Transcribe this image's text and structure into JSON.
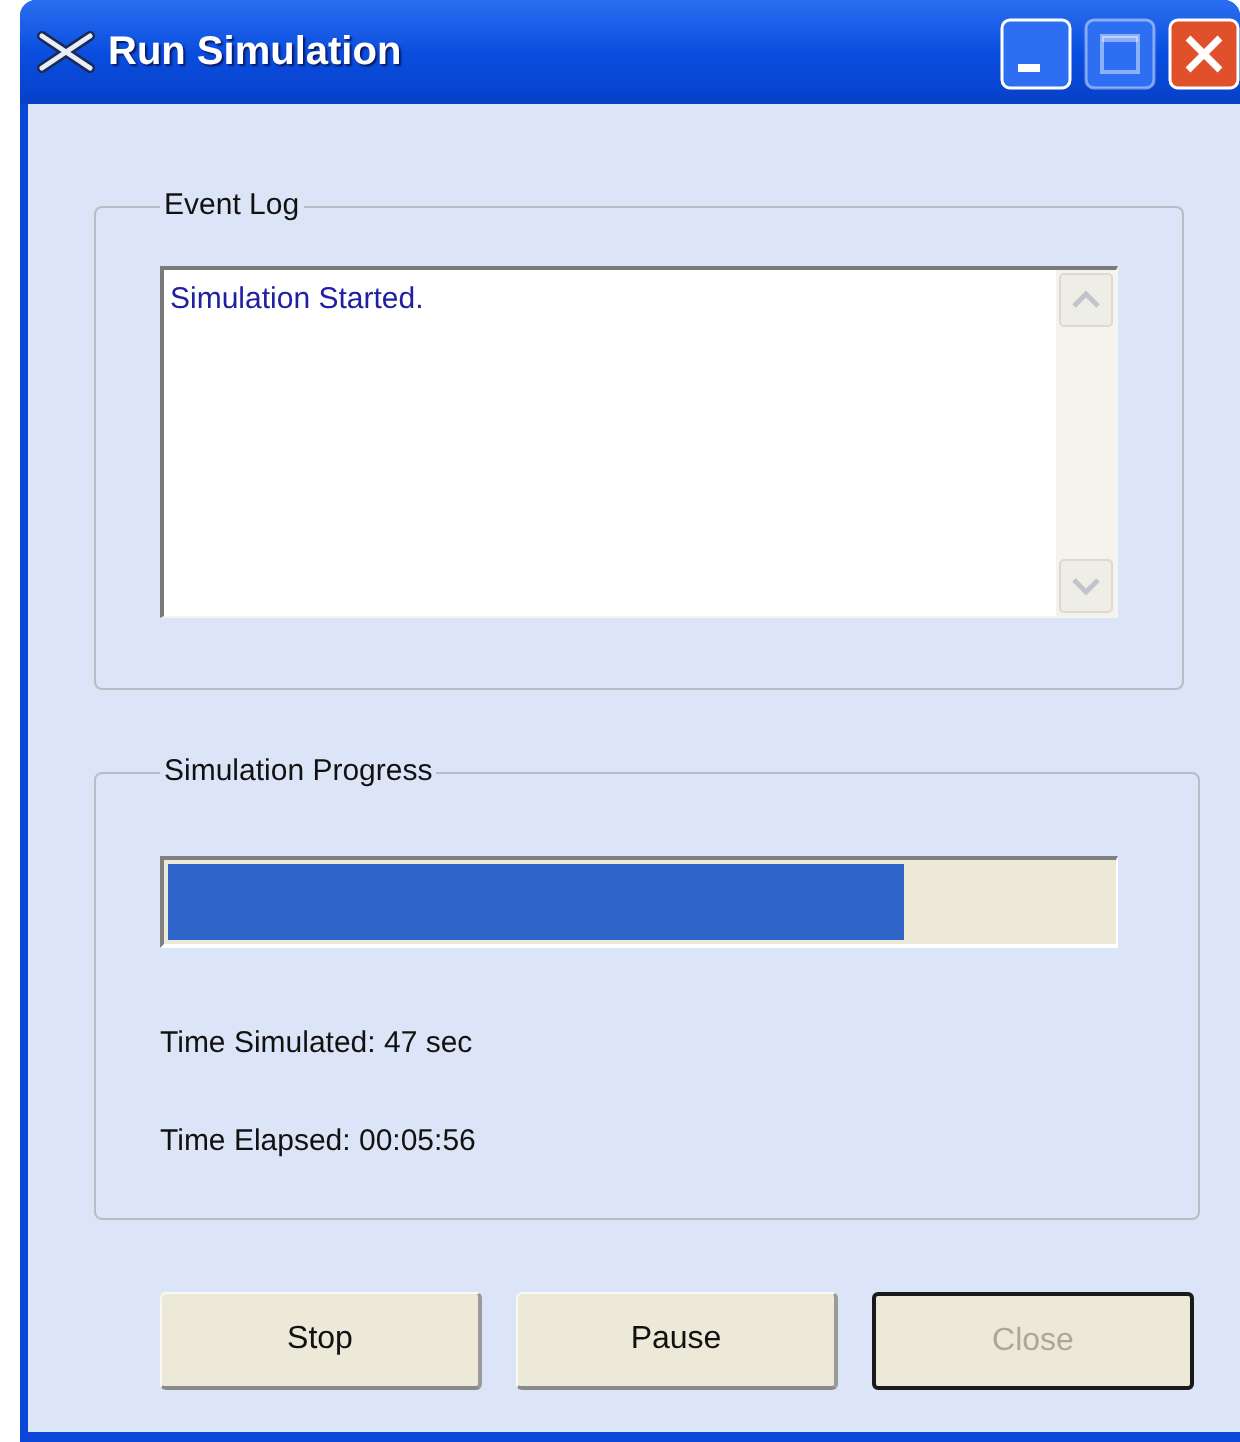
{
  "window": {
    "title": "Run Simulation",
    "title_buttons": [
      {
        "kind": "minimize",
        "disabled": false
      },
      {
        "kind": "maximize",
        "disabled": true
      },
      {
        "kind": "close",
        "disabled": false
      }
    ]
  },
  "event_log": {
    "legend": "Event Log",
    "entries": [
      "Simulation Started."
    ]
  },
  "progress": {
    "legend": "Simulation Progress",
    "level": 0.78,
    "time_simulated": "Time Simulated: 47 sec",
    "time_elapsed": "Time Elapsed: 00:05:56"
  },
  "buttons": [
    {
      "label": "Stop",
      "disabled": false,
      "default": false
    },
    {
      "label": "Pause",
      "disabled": false,
      "default": false
    },
    {
      "label": "Close",
      "disabled": true,
      "default": true
    }
  ]
}
